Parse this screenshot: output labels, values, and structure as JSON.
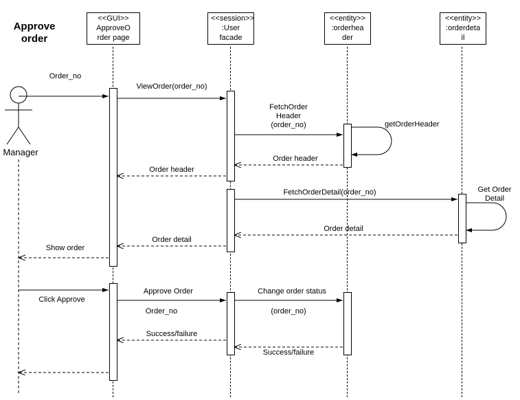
{
  "title_line1": "Approve",
  "title_line2": "order",
  "actor_name": "Manager",
  "lifelines": {
    "gui": {
      "stereo": "<<GUI>>",
      "name": "ApproveO\nrder page"
    },
    "session": {
      "stereo": "<<session>>",
      "name": ":User\nfacade"
    },
    "header": {
      "stereo": "<<entity>>",
      "name": ":orderhea\nder"
    },
    "detail": {
      "stereo": "<<entity>>",
      "name": ":orderdeta\nil"
    }
  },
  "messages": {
    "m1": "Order_no",
    "m2": "ViewOrder(order_no)",
    "m3a": "FetchOrder",
    "m3b": "Header",
    "m3c": "(order_no)",
    "m4": "getOrderHeader",
    "m5": "Order header",
    "m6": "Order header",
    "m7": "FetchOrderDetail(order_no)",
    "m8a": "Get Order",
    "m8b": "Detail",
    "m9": "Order detail",
    "m10": "Order detail",
    "m11": "Show order",
    "m12": "Click Approve",
    "m13": "Approve Order",
    "m14": "Order_no",
    "m15": "Change order status",
    "m16": "(order_no)",
    "m17": "Success/failure",
    "m18": "Success/failure"
  },
  "chart_data": {
    "type": "uml-sequence-diagram",
    "title": "Approve order",
    "actors": [
      {
        "id": "manager",
        "name": "Manager",
        "kind": "actor"
      }
    ],
    "lifelines": [
      {
        "id": "gui",
        "stereotype": "GUI",
        "name": "ApproveOrder page"
      },
      {
        "id": "session",
        "stereotype": "session",
        "name": ":User facade"
      },
      {
        "id": "header",
        "stereotype": "entity",
        "name": ":orderheader"
      },
      {
        "id": "detail",
        "stereotype": "entity",
        "name": ":orderdetail"
      }
    ],
    "messages": [
      {
        "from": "manager",
        "to": "gui",
        "label": "Order_no",
        "type": "sync"
      },
      {
        "from": "gui",
        "to": "session",
        "label": "ViewOrder(order_no)",
        "type": "sync"
      },
      {
        "from": "session",
        "to": "header",
        "label": "FetchOrderHeader(order_no)",
        "type": "sync"
      },
      {
        "from": "header",
        "to": "header",
        "label": "getOrderHeader",
        "type": "self"
      },
      {
        "from": "header",
        "to": "session",
        "label": "Order header",
        "type": "return"
      },
      {
        "from": "session",
        "to": "gui",
        "label": "Order header",
        "type": "return"
      },
      {
        "from": "session",
        "to": "detail",
        "label": "FetchOrderDetail(order_no)",
        "type": "sync"
      },
      {
        "from": "detail",
        "to": "detail",
        "label": "Get Order Detail",
        "type": "self"
      },
      {
        "from": "detail",
        "to": "session",
        "label": "Order detail",
        "type": "return"
      },
      {
        "from": "session",
        "to": "gui",
        "label": "Order detail",
        "type": "return"
      },
      {
        "from": "gui",
        "to": "manager",
        "label": "Show order",
        "type": "return"
      },
      {
        "from": "manager",
        "to": "gui",
        "label": "Click Approve",
        "type": "sync"
      },
      {
        "from": "gui",
        "to": "session",
        "label": "Approve Order Order_no",
        "type": "sync"
      },
      {
        "from": "session",
        "to": "header",
        "label": "Change order status (order_no)",
        "type": "sync"
      },
      {
        "from": "header",
        "to": "session",
        "label": "Success/failure",
        "type": "return"
      },
      {
        "from": "session",
        "to": "gui",
        "label": "Success/failure",
        "type": "return"
      },
      {
        "from": "gui",
        "to": "manager",
        "label": "",
        "type": "return"
      }
    ]
  }
}
